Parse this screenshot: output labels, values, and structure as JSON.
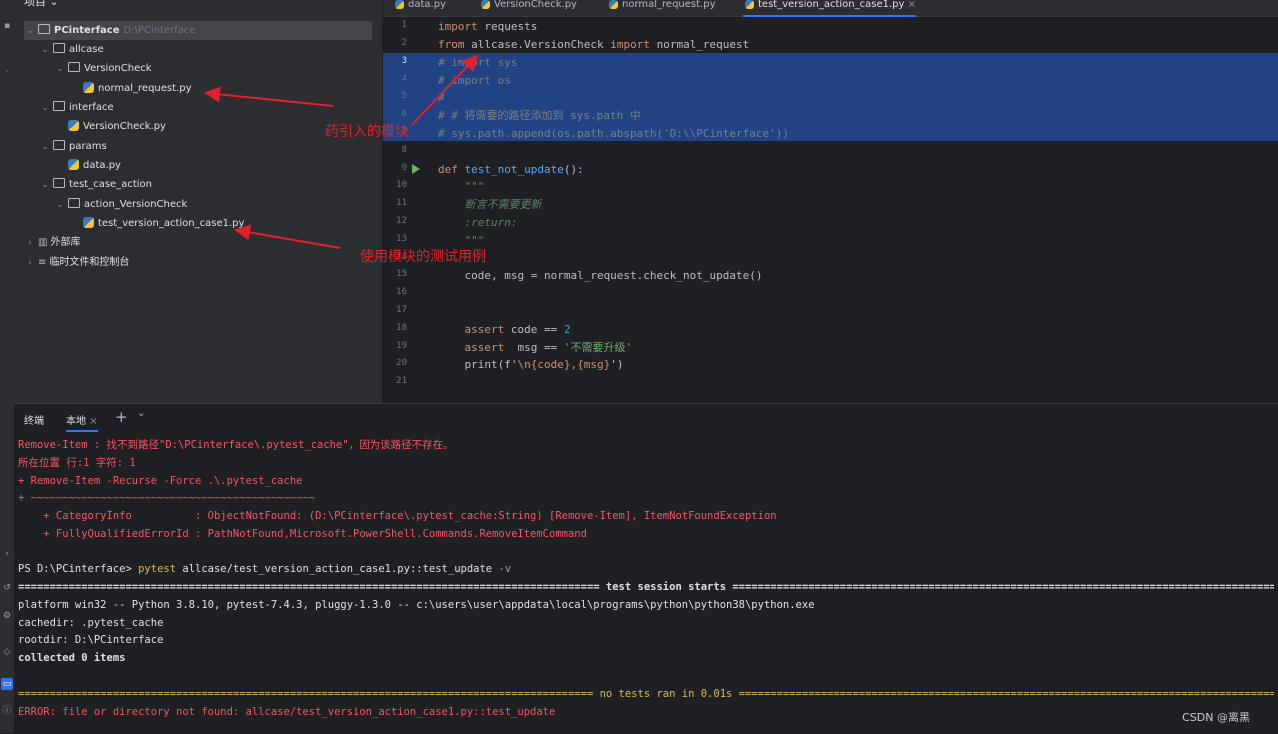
{
  "project_panel": {
    "header": "项目",
    "root": {
      "name": "PCinterface",
      "path": "D:\\PCinterface"
    },
    "items": [
      "allcase",
      "VersionCheck",
      "normal_request.py",
      "interface",
      "VersionCheck.py",
      "params",
      "data.py",
      "test_case_action",
      "action_VersionCheck",
      "test_version_action_case1.py",
      "外部库",
      "临时文件和控制台"
    ]
  },
  "editor_tabs": [
    "data.py",
    "VersionCheck.py",
    "normal_request.py",
    "test_version_action_case1.py"
  ],
  "tab_close": "×",
  "line_numbers": [
    "1",
    "2",
    "3",
    "4",
    "5",
    "6",
    "7",
    "8",
    "9",
    "10",
    "11",
    "12",
    "13",
    "14",
    "15",
    "16",
    "17",
    "18",
    "19",
    "20",
    "21"
  ],
  "code": {
    "l1_kw": "import",
    "l1_rest": " requests",
    "l2_kw1": "from",
    "l2_mid": " allcase.VersionCheck ",
    "l2_kw2": "import",
    "l2_rest": " normal_request",
    "l3": "# import sys",
    "l4": "# import os",
    "l5": "#",
    "l6": "# # 将需要的路径添加到 sys.path 中",
    "l7": "# sys.path.append(os.path.abspath('D:\\\\PCinterface'))",
    "l9_kw": "def",
    "l9_fn": "test_not_update",
    "l9_rest": "():",
    "l10": "    \"\"\"",
    "l11": "    断言不需要更新",
    "l12": "    :return:",
    "l13": "    \"\"\"",
    "l14": "    code, msg = normal_request.check_not_update()",
    "l18_kw": "    assert",
    "l18_mid": " code == ",
    "l18_num": "2",
    "l19_kw": "    assert",
    "l19_mid": "  msg == ",
    "l19_str": "'不需要升级'",
    "l20_a": "    print(f'",
    "l20_b": "\\n{code},{msg}",
    "l20_c": "')"
  },
  "annotations": {
    "module": "药引入的模块",
    "testcase": "使用模块的测试用例"
  },
  "terminal": {
    "tabs": [
      "终端",
      "本地"
    ],
    "tab_close": "×",
    "add": "+",
    "dropdown": "⌄",
    "lines": [
      "Remove-Item : 找不到路径\"D:\\PCinterface\\.pytest_cache\"，因为该路径不存在。",
      "所在位置 行:1 字符: 1",
      "+ Remove-Item -Recurse -Force .\\.pytest_cache",
      "+ ~~~~~~~~~~~~~~~~~~~~~~~~~~~~~~~~~~~~~~~~~~~~~",
      "    + CategoryInfo          : ObjectNotFound: (D:\\PCinterface\\.pytest_cache:String) [Remove-Item], ItemNotFoundException",
      "    + FullyQualifiedErrorId : PathNotFound,Microsoft.PowerShell.Commands.RemoveItemCommand"
    ],
    "prompt": "PS D:\\PCinterface> ",
    "cmd": "pytest",
    "cmd_args": " allcase/test_version_action_case1.py::test_update ",
    "cmd_flag": "-v",
    "session_line": "============================================================================================ test session starts ================================================================================================",
    "platform": "platform win32 -- Python 3.8.10, pytest-7.4.3, pluggy-1.3.0 -- c:\\users\\user\\appdata\\local\\programs\\python\\python38\\python.exe",
    "cachedir": "cachedir: .pytest_cache",
    "rootdir": "rootdir: D:\\PCinterface",
    "collected": "collected 0 items",
    "no_tests": "=========================================================================================== no tests ran in 0.01s ==============================================================================================",
    "error": "ERROR: file or directory not found: allcase/test_version_action_case1.py::test_update"
  },
  "watermark": "CSDN @离黑"
}
